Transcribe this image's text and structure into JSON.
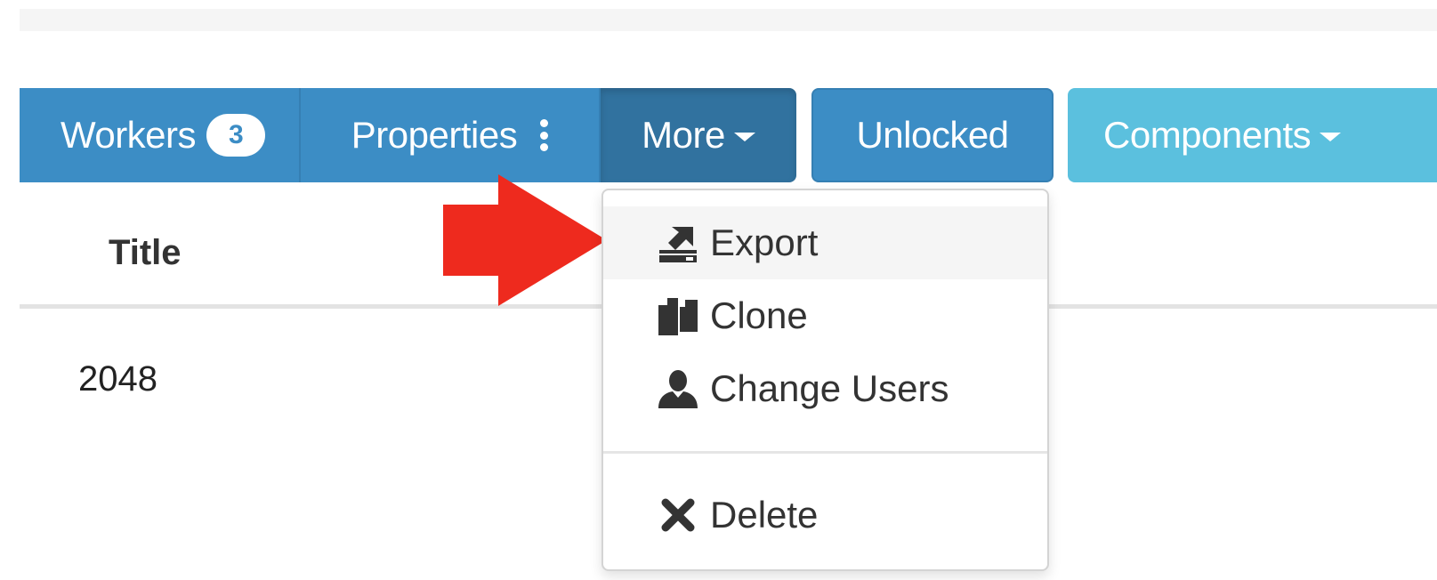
{
  "toolbar": {
    "workers_label": "Workers",
    "workers_count": "3",
    "properties_label": "Properties",
    "more_label": "More",
    "unlocked_label": "Unlocked",
    "components_label": "Components"
  },
  "table": {
    "header_title": "Title",
    "rows": [
      {
        "value": "2048"
      }
    ]
  },
  "dropdown": {
    "items": [
      {
        "label": "Export",
        "icon": "export-icon"
      },
      {
        "label": "Clone",
        "icon": "clone-icon"
      },
      {
        "label": "Change Users",
        "icon": "user-icon"
      },
      {
        "label": "Delete",
        "icon": "close-icon"
      }
    ]
  },
  "colors": {
    "primary": "#3c8dc5",
    "primary_active": "#31729f",
    "info": "#5bc0de",
    "annotation_arrow": "#ee2a1e"
  }
}
